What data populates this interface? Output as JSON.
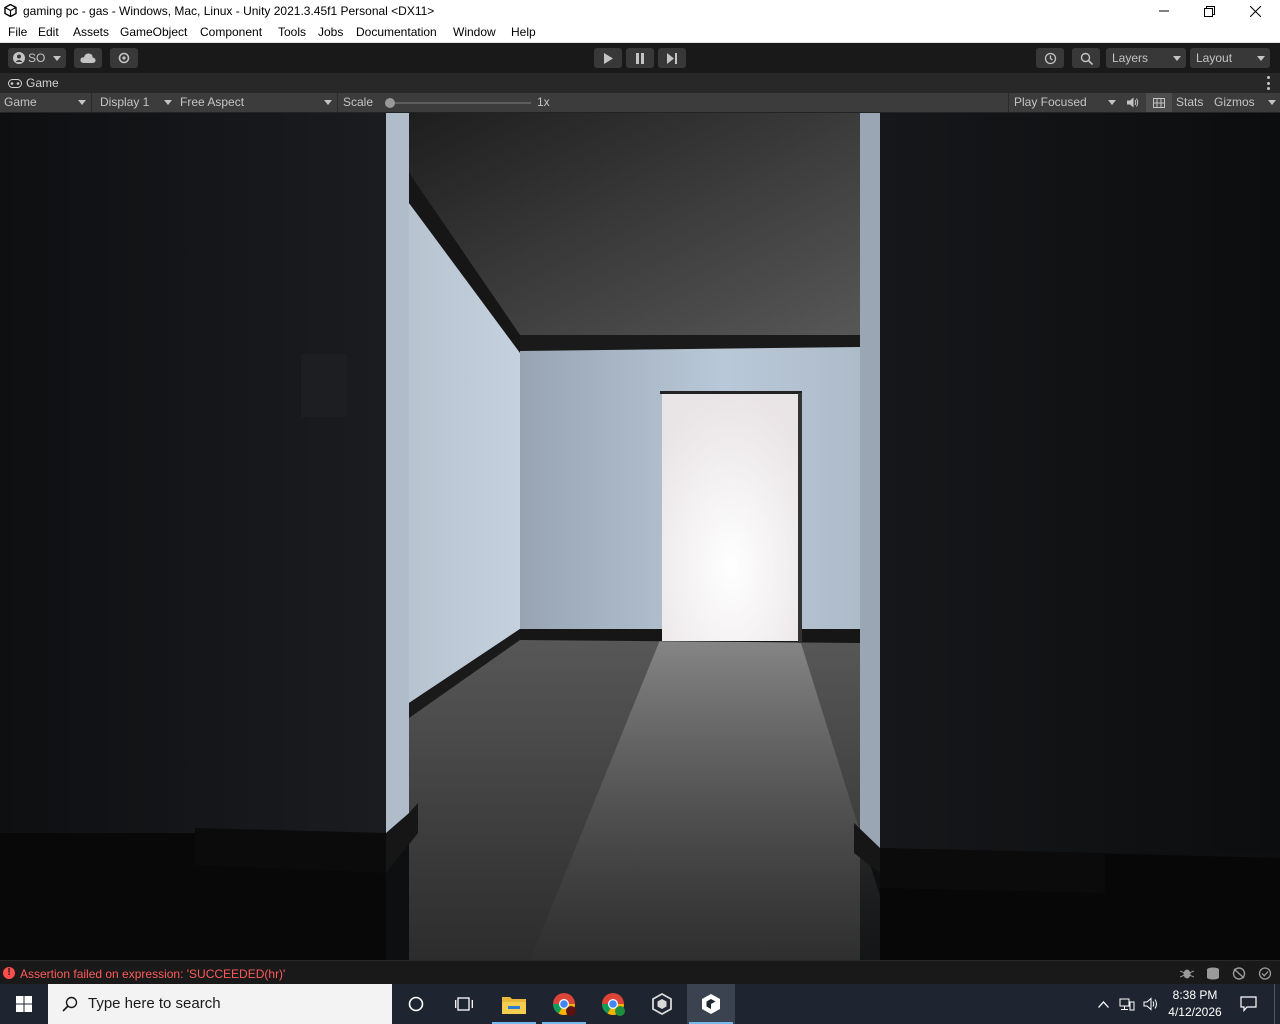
{
  "window": {
    "title": "gaming pc - gas - Windows, Mac, Linux - Unity 2021.3.45f1 Personal <DX11>",
    "controls": [
      "minimize-icon",
      "restore-icon",
      "close-icon"
    ]
  },
  "menu": [
    "File",
    "Edit",
    "Assets",
    "GameObject",
    "Component",
    "Tools",
    "Jobs",
    "Documentation",
    "Window",
    "Help"
  ],
  "toolbar": {
    "account_label": "SO",
    "layers_label": "Layers",
    "layout_label": "Layout"
  },
  "game_tab": {
    "label": "Game"
  },
  "game_toolbar": {
    "view_select": "Game",
    "display_select": "Display 1",
    "aspect_select": "Free Aspect",
    "scale_label": "Scale",
    "scale_value": "1x",
    "scale_slider_fraction": 0,
    "play_mode_select": "Play Focused",
    "stats_label": "Stats",
    "gizmos_label": "Gizmos"
  },
  "status": {
    "error_text": "Assertion failed on expression: 'SUCCEEDED(hr)'"
  },
  "taskbar": {
    "search_placeholder": "Type here to search",
    "time": "8:38 PM",
    "date": "4/12/2026",
    "apps": [
      "windows-start-icon",
      "cortana-icon",
      "task-view-icon",
      "file-explorer-icon",
      "chrome-icon",
      "chrome-profile-icon",
      "unity-hub-icon",
      "unity-editor-icon"
    ]
  },
  "colors": {
    "editor_bg": "#191919",
    "toolbar_btn": "#383838",
    "error_red": "#ff5a5a",
    "taskbar_bg": "#1f2530",
    "active_indicator": "#76b9ed"
  }
}
